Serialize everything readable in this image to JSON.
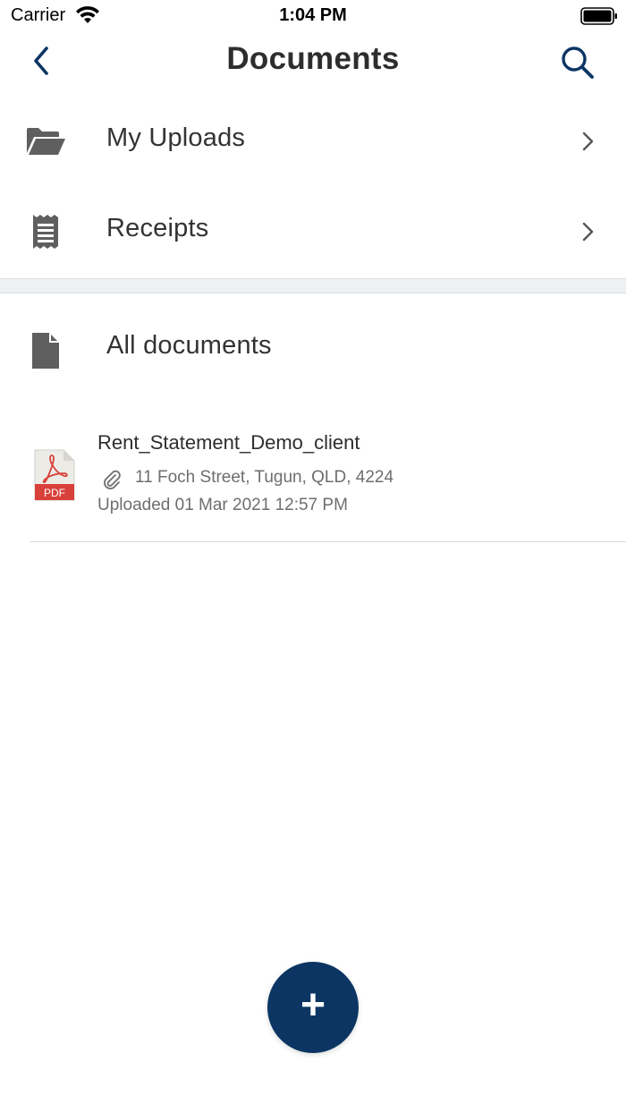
{
  "status_bar": {
    "carrier": "Carrier",
    "time": "1:04 PM",
    "icons": [
      "wifi-icon",
      "battery-icon"
    ]
  },
  "nav": {
    "title": "Documents",
    "back_icon": "chevron-left-icon",
    "search_icon": "search-icon"
  },
  "menu": {
    "items": [
      {
        "label": "My Uploads",
        "icon": "open-folder-icon"
      },
      {
        "label": "Receipts",
        "icon": "receipt-icon"
      }
    ]
  },
  "all_documents": {
    "label": "All documents",
    "icon": "document-icon"
  },
  "documents": [
    {
      "name": "Rent_Statement_Demo_client",
      "type_badge": "PDF",
      "address": "11 Foch Street, Tugun, QLD, 4224",
      "uploaded": "Uploaded 01 Mar 2021 12:57 PM"
    }
  ],
  "fab": {
    "symbol": "+",
    "icon": "plus-icon"
  },
  "colors": {
    "accent": "#0c3563",
    "icon_gray": "#5f5f5f",
    "pdf_red": "#d9403a",
    "separator": "#eef1f4"
  }
}
